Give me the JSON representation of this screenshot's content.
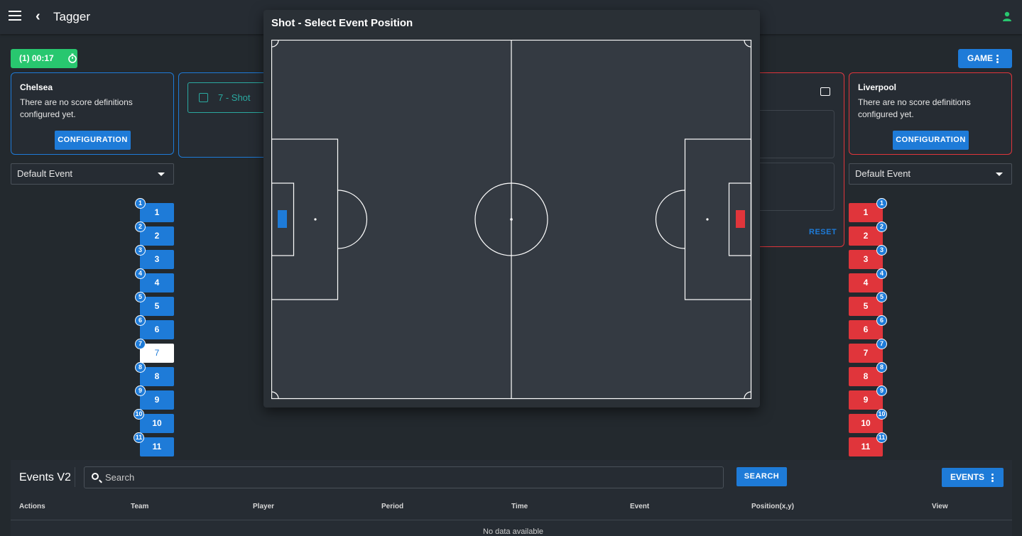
{
  "app": {
    "title": "Tagger"
  },
  "timer": {
    "label": "(1) 00:17"
  },
  "game_button": {
    "label": "GAME"
  },
  "home_team": {
    "name": "Chelsea",
    "message": "There are no score definitions configured yet.",
    "config_label": "CONFIGURATION",
    "dropdown_value": "Default Event",
    "color": "#1e7bd8",
    "players": [
      "1",
      "2",
      "3",
      "4",
      "5",
      "6",
      "7",
      "8",
      "9",
      "10",
      "11"
    ],
    "selected_player": "7"
  },
  "away_team": {
    "name": "Liverpool",
    "message": "There are no score definitions configured yet.",
    "config_label": "CONFIGURATION",
    "dropdown_value": "Default Event",
    "color": "#e0353b",
    "players": [
      "1",
      "2",
      "3",
      "4",
      "5",
      "6",
      "7",
      "8",
      "9",
      "10",
      "11"
    ]
  },
  "event_field": {
    "value": "7 - Shot"
  },
  "reset_label": "RESET",
  "modal": {
    "title": "Shot - Select Event Position"
  },
  "events_panel": {
    "title": "Events V2",
    "search_placeholder": "Search",
    "search_button": "SEARCH",
    "events_button": "EVENTS",
    "columns": [
      "Actions",
      "Team",
      "Player",
      "Period",
      "Time",
      "Event",
      "Position(x,y)",
      "View"
    ],
    "empty_text": "No data available"
  }
}
